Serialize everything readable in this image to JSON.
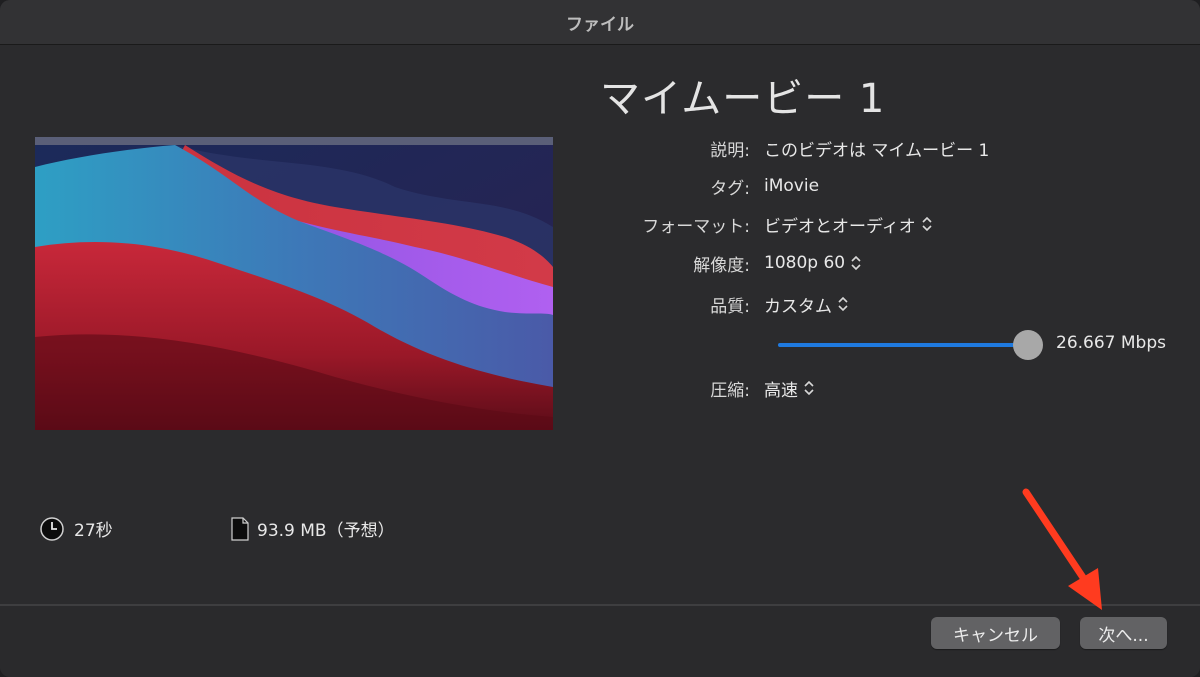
{
  "window": {
    "title": "ファイル"
  },
  "movie": {
    "title": "マイムービー 1"
  },
  "fields": {
    "description": {
      "label": "説明:",
      "value": "このビデオは マイムービー 1"
    },
    "tags": {
      "label": "タグ:",
      "value": "iMovie"
    },
    "format": {
      "label": "フォーマット:",
      "value": "ビデオとオーディオ"
    },
    "resolution": {
      "label": "解像度:",
      "value": "1080p 60"
    },
    "quality": {
      "label": "品質:",
      "value": "カスタム"
    },
    "compression": {
      "label": "圧縮:",
      "value": "高速"
    }
  },
  "bitrate": {
    "value": "26.667 Mbps"
  },
  "stats": {
    "duration": "27秒",
    "size": "93.9 MB（予想）"
  },
  "buttons": {
    "cancel": "キャンセル",
    "next": "次へ..."
  },
  "colors": {
    "slider_accent": "#1f7ae0",
    "annotation_arrow": "#ff3b1f"
  },
  "icons": {
    "duration": "clock-icon",
    "size": "document-icon",
    "stepper": "up-down-chevron-icon"
  }
}
